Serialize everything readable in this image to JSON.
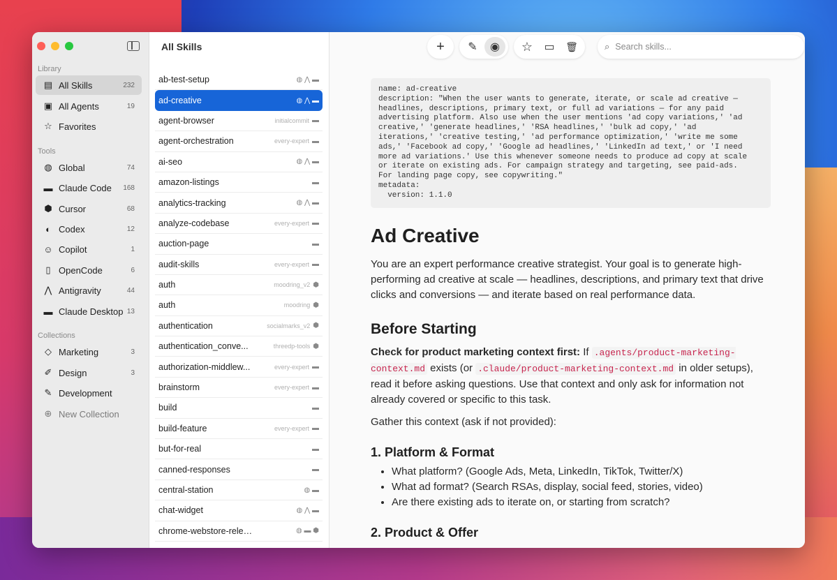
{
  "sidebar": {
    "sections": {
      "library": "Library",
      "tools": "Tools",
      "collections": "Collections"
    },
    "library": [
      {
        "label": "All Skills",
        "count": "232",
        "icon": "document-icon"
      },
      {
        "label": "All Agents",
        "count": "19",
        "icon": "person-card-icon"
      },
      {
        "label": "Favorites",
        "count": "",
        "icon": "star-icon"
      }
    ],
    "tools": [
      {
        "label": "Global",
        "count": "74",
        "icon": "globe-icon"
      },
      {
        "label": "Claude Code",
        "count": "168",
        "icon": "claude-code-icon"
      },
      {
        "label": "Cursor",
        "count": "68",
        "icon": "cursor-cube-icon"
      },
      {
        "label": "Codex",
        "count": "12",
        "icon": "codex-icon"
      },
      {
        "label": "Copilot",
        "count": "1",
        "icon": "copilot-icon"
      },
      {
        "label": "OpenCode",
        "count": "6",
        "icon": "opencode-icon"
      },
      {
        "label": "Antigravity",
        "count": "44",
        "icon": "antigravity-icon"
      },
      {
        "label": "Claude Desktop",
        "count": "13",
        "icon": "claude-desktop-icon"
      }
    ],
    "collections": [
      {
        "label": "Marketing",
        "count": "3",
        "icon": "tag-icon"
      },
      {
        "label": "Design",
        "count": "3",
        "icon": "brush-icon"
      },
      {
        "label": "Development",
        "count": "",
        "icon": "wrench-icon"
      },
      {
        "label": "New Collection",
        "count": "",
        "icon": "plus-circle-icon"
      }
    ]
  },
  "list": {
    "title": "All Skills",
    "rows": [
      {
        "name": "ab-test-setup",
        "tag": "",
        "icons": "◍ ⋀ ▬"
      },
      {
        "name": "ad-creative",
        "tag": "",
        "icons": "◍ ⋀ ▬"
      },
      {
        "name": "agent-browser",
        "tag": "initialcommit",
        "icons": "▬"
      },
      {
        "name": "agent-orchestration",
        "tag": "every-expert",
        "icons": "▬"
      },
      {
        "name": "ai-seo",
        "tag": "",
        "icons": "◍ ⋀ ▬"
      },
      {
        "name": "amazon-listings",
        "tag": "",
        "icons": "▬"
      },
      {
        "name": "analytics-tracking",
        "tag": "",
        "icons": "◍ ⋀ ▬"
      },
      {
        "name": "analyze-codebase",
        "tag": "every-expert",
        "icons": "▬"
      },
      {
        "name": "auction-page",
        "tag": "",
        "icons": "▬"
      },
      {
        "name": "audit-skills",
        "tag": "every-expert",
        "icons": "▬"
      },
      {
        "name": "auth",
        "tag": "moodring_v2",
        "icons": "⬢"
      },
      {
        "name": "auth",
        "tag": "moodring",
        "icons": "⬢"
      },
      {
        "name": "authentication",
        "tag": "socialmarks_v2",
        "icons": "⬢"
      },
      {
        "name": "authentication_conve...",
        "tag": "threedp-tools",
        "icons": "⬢"
      },
      {
        "name": "authorization-middlew...",
        "tag": "every-expert",
        "icons": "▬"
      },
      {
        "name": "brainstorm",
        "tag": "every-expert",
        "icons": "▬"
      },
      {
        "name": "build",
        "tag": "",
        "icons": "▬"
      },
      {
        "name": "build-feature",
        "tag": "every-expert",
        "icons": "▬"
      },
      {
        "name": "but-for-real",
        "tag": "",
        "icons": "▬"
      },
      {
        "name": "canned-responses",
        "tag": "",
        "icons": "▬"
      },
      {
        "name": "central-station",
        "tag": "",
        "icons": "◍ ▬"
      },
      {
        "name": "chat-widget",
        "tag": "",
        "icons": "◍ ⋀ ▬"
      },
      {
        "name": "chrome-webstore-release-...",
        "tag": "",
        "icons": "◍ ▬ ⬢"
      }
    ]
  },
  "toolbar": {
    "add": "+",
    "edit": "✎",
    "preview": "◉",
    "favorite": "☆",
    "folder": "▭",
    "delete": "🗑"
  },
  "search": {
    "placeholder": "Search skills..."
  },
  "doc": {
    "frontmatter": "name: ad-creative\ndescription: \"When the user wants to generate, iterate, or scale ad creative —\nheadlines, descriptions, primary text, or full ad variations — for any paid\nadvertising platform. Also use when the user mentions 'ad copy variations,' 'ad\ncreative,' 'generate headlines,' 'RSA headlines,' 'bulk ad copy,' 'ad\niterations,' 'creative testing,' 'ad performance optimization,' 'write me some\nads,' 'Facebook ad copy,' 'Google ad headlines,' 'LinkedIn ad text,' or 'I need\nmore ad variations.' Use this whenever someone needs to produce ad copy at scale\nor iterate on existing ads. For campaign strategy and targeting, see paid-ads.\nFor landing page copy, see copywriting.\"\nmetadata:\n  version: 1.1.0",
    "title": "Ad Creative",
    "intro": "You are an expert performance creative strategist. Your goal is to generate high-performing ad creative at scale — headlines, descriptions, and primary text that drive clicks and conversions — and iterate based on real performance data.",
    "before_heading": "Before Starting",
    "check_bold": "Check for product marketing context first:",
    "check_if": " If ",
    "check_path1": ".agents/product-marketing-context.md",
    "check_mid": " exists (or ",
    "check_path2": ".claude/product-marketing-context.md",
    "check_end": " in older setups), read it before asking questions. Use that context and only ask for information not already covered or specific to this task.",
    "gather": "Gather this context (ask if not provided):",
    "platform_heading": "1. Platform & Format",
    "platform_items": [
      "What platform? (Google Ads, Meta, LinkedIn, TikTok, Twitter/X)",
      "What ad format? (Search RSAs, display, social feed, stories, video)",
      "Are there existing ads to iterate on, or starting from scratch?"
    ],
    "product_heading": "2. Product & Offer"
  }
}
